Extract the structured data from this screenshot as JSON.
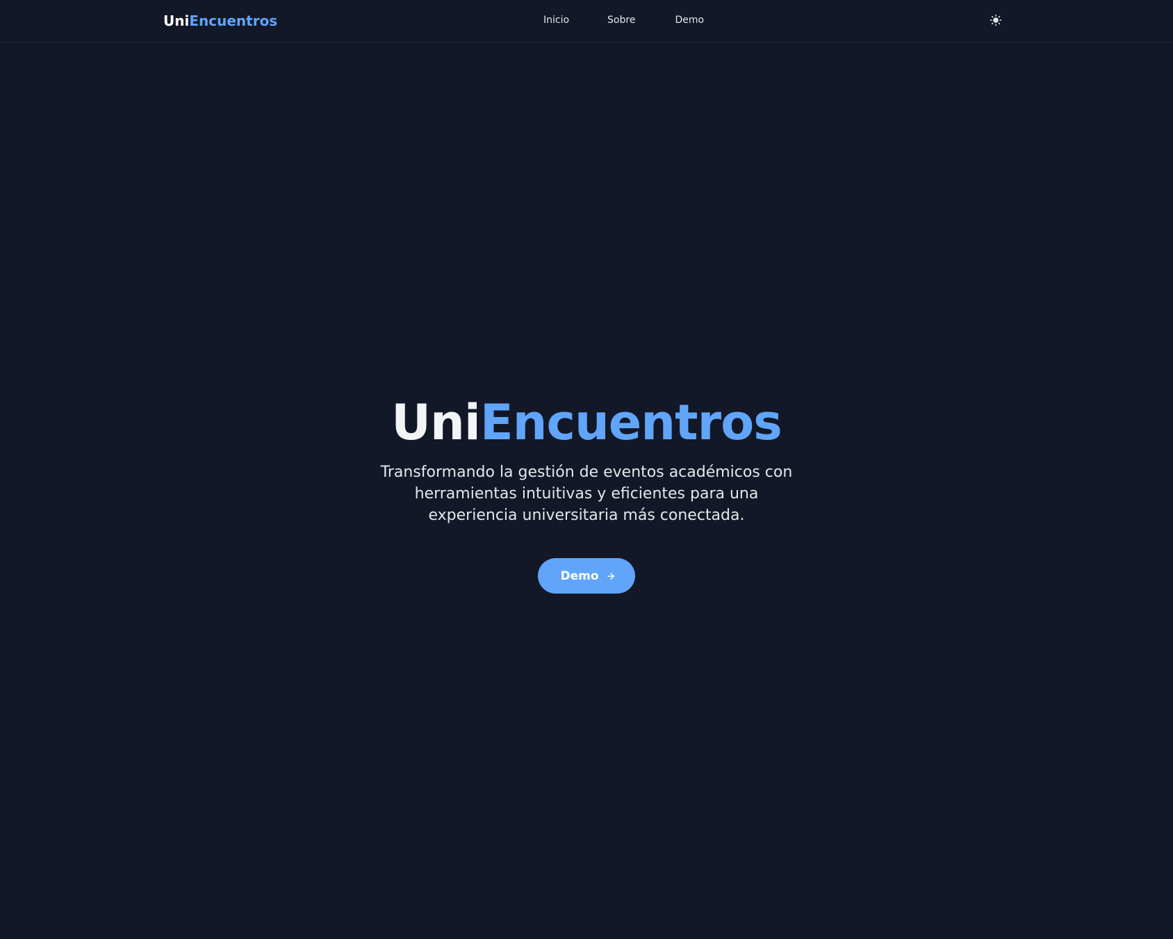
{
  "brand": {
    "name_part_1": "Uni",
    "name_part_2": "Encuentros"
  },
  "nav": {
    "links": [
      "Inicio",
      "Sobre",
      "Demo"
    ],
    "theme_toggle_icon": "sun-icon"
  },
  "hero": {
    "title_part_1": "Uni",
    "title_part_2": "Encuentros",
    "subtitle": "Transformando la gestión de eventos académicos con herramientas intuitivas y eficientes para una experiencia universitaria más conectada.",
    "cta_label": "Demo",
    "cta_icon": "arrow-right-icon"
  },
  "colors": {
    "background": "#121827",
    "accent": "#60a5fa",
    "text": "#e5e7eb"
  }
}
